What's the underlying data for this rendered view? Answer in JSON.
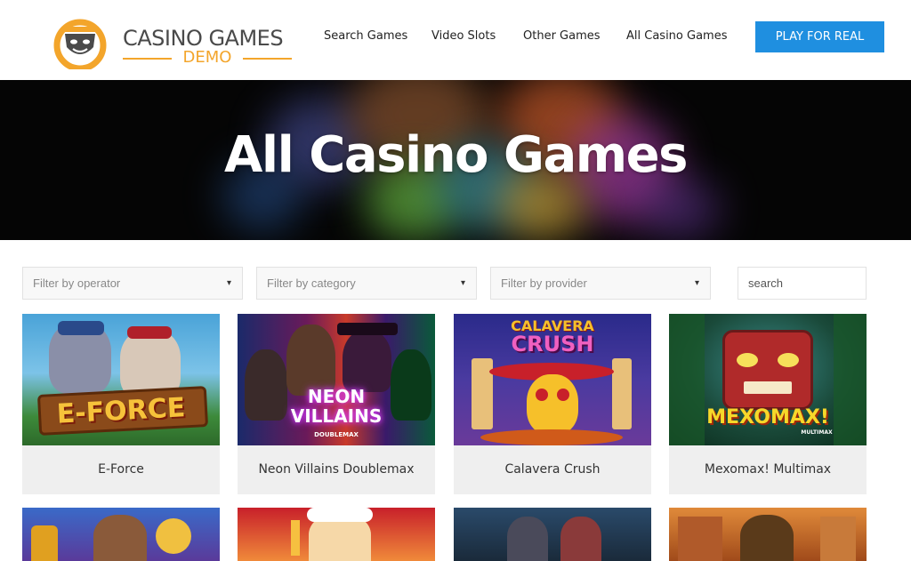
{
  "header": {
    "logo_title": "CASINO GAMES",
    "logo_sub": "DEMO",
    "nav": [
      "Search Games",
      "Video Slots",
      "Other Games",
      "All Casino Games"
    ],
    "cta_label": "PLAY FOR REAL",
    "colors": {
      "brand_orange": "#f3a52b",
      "cta_blue": "#1f8fe0"
    }
  },
  "hero": {
    "title": "All Casino Games"
  },
  "filters": {
    "operator_placeholder": "Filter by operator",
    "category_placeholder": "Filter by category",
    "provider_placeholder": "Filter by provider",
    "search_placeholder": "search",
    "caret_icon": "▾"
  },
  "games": [
    {
      "title": "E-Force",
      "art_text": "E-FORCE"
    },
    {
      "title": "Neon Villains Doublemax",
      "art_text": "NEON VILLAINS",
      "art_sub": "DOUBLEMAX"
    },
    {
      "title": "Calavera Crush",
      "art_text": "CALAVERA",
      "art_text2": "CRUSH"
    },
    {
      "title": "Mexomax! Multimax",
      "art_text": "MEXOMAX!",
      "art_sub": "MULTIMAX"
    }
  ]
}
